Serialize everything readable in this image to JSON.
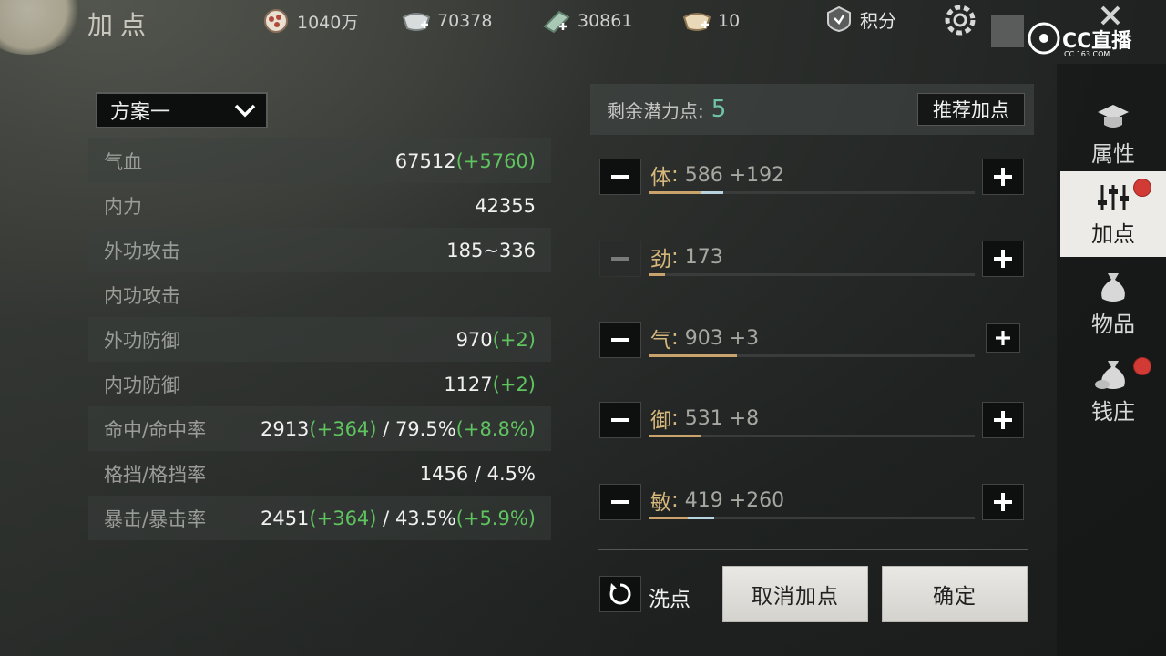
{
  "header": {
    "title": "加点",
    "resources": [
      {
        "icon": "coin-stack-icon",
        "value": "1040万"
      },
      {
        "icon": "silver-ingot-icon",
        "value": "70378"
      },
      {
        "icon": "jade-token-icon",
        "value": "30861"
      },
      {
        "icon": "gold-ingot-icon",
        "value": "10"
      }
    ],
    "score_label": "积分",
    "watermark_text": "CC直播",
    "watermark_sub": "CC.163.COM"
  },
  "scheme": {
    "selected": "方案一"
  },
  "stats": [
    {
      "name": "气血",
      "base": "67512",
      "bonus": "(+5760)",
      "sep": "",
      "base2": "",
      "bonus2": ""
    },
    {
      "name": "内力",
      "base": "42355",
      "bonus": "",
      "sep": "",
      "base2": "",
      "bonus2": ""
    },
    {
      "name": "外功攻击",
      "base": "185~336",
      "bonus": "",
      "sep": "",
      "base2": "",
      "bonus2": ""
    },
    {
      "name": "内功攻击",
      "base": "",
      "bonus": "",
      "sep": "",
      "base2": "",
      "bonus2": ""
    },
    {
      "name": "外功防御",
      "base": "970",
      "bonus": "(+2)",
      "sep": "",
      "base2": "",
      "bonus2": ""
    },
    {
      "name": "内功防御",
      "base": "1127",
      "bonus": "(+2)",
      "sep": "",
      "base2": "",
      "bonus2": ""
    },
    {
      "name": "命中/命中率",
      "base": "2913",
      "bonus": "(+364)",
      "sep": " / ",
      "base2": "79.5%",
      "bonus2": "(+8.8%)"
    },
    {
      "name": "格挡/格挡率",
      "base": "1456",
      "bonus": "",
      "sep": " / ",
      "base2": "4.5%",
      "bonus2": ""
    },
    {
      "name": "暴击/暴击率",
      "base": "2451",
      "bonus": "(+364)",
      "sep": " / ",
      "base2": "43.5%",
      "bonus2": "(+5.9%)"
    }
  ],
  "potential": {
    "label": "剩余潜力点:",
    "value": "5",
    "recommend_label": "推荐加点"
  },
  "attributes": [
    {
      "name": "体",
      "colon": ":",
      "value": "586",
      "bonus": "+192",
      "fill": 0.16,
      "bonus_fill": 0.07,
      "minus_enabled": true
    },
    {
      "name": "劲",
      "colon": ":",
      "value": "173",
      "bonus": "",
      "fill": 0.05,
      "bonus_fill": 0,
      "minus_enabled": false
    },
    {
      "name": "气",
      "colon": ":",
      "value": "903",
      "bonus": "+3",
      "fill": 0.27,
      "bonus_fill": 0,
      "minus_enabled": true
    },
    {
      "name": "御",
      "colon": ":",
      "value": "531",
      "bonus": "+8",
      "fill": 0.16,
      "bonus_fill": 0,
      "minus_enabled": true
    },
    {
      "name": "敏",
      "colon": ":",
      "value": "419",
      "bonus": "+260",
      "fill": 0.12,
      "bonus_fill": 0.08,
      "minus_enabled": true
    }
  ],
  "actions": {
    "wash_label": "洗点",
    "cancel_label": "取消加点",
    "confirm_label": "确定"
  },
  "sidebar": {
    "items": [
      {
        "label": "属性",
        "icon": "scholar-hat-icon",
        "badge": false
      },
      {
        "label": "加点",
        "icon": "sliders-icon",
        "badge": true
      },
      {
        "label": "物品",
        "icon": "bag-icon",
        "badge": false
      },
      {
        "label": "钱庄",
        "icon": "money-bag-icon",
        "badge": true
      }
    ]
  },
  "colors": {
    "bonus_green": "#5fc35f",
    "potential_teal": "#6fc3a6",
    "attr_gold": "#d7b87c",
    "badge_red": "#d23a36"
  }
}
